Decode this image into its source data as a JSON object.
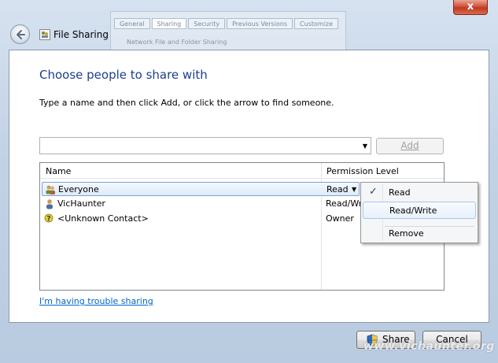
{
  "window": {
    "title": "File Sharing",
    "close_label": "x"
  },
  "background_window": {
    "tabs": [
      "General",
      "Sharing",
      "Security",
      "Previous Versions",
      "Customize"
    ],
    "active_tab": "Sharing",
    "line": "Network File and Folder Sharing"
  },
  "main": {
    "heading": "Choose people to share with",
    "instruction": "Type a name and then click Add, or click the arrow to find someone.",
    "name_input": {
      "value": "",
      "placeholder": ""
    },
    "add_label": "Add"
  },
  "list": {
    "columns": {
      "name": "Name",
      "permission": "Permission Level"
    },
    "rows": [
      {
        "name": "Everyone",
        "permission": "Read",
        "icon": "group-users-icon",
        "selected": true
      },
      {
        "name": "VicHaunter",
        "permission": "Read/Wr",
        "icon": "user-icon",
        "selected": false
      },
      {
        "name": "<Unknown Contact>",
        "permission": "Owner",
        "icon": "unknown-contact-icon",
        "selected": false
      }
    ]
  },
  "permission_menu": {
    "items": [
      {
        "label": "Read",
        "checked": true
      },
      {
        "label": "Read/Write",
        "checked": false
      },
      {
        "label": "Remove",
        "checked": false
      }
    ]
  },
  "trouble_link": "I'm having trouble sharing",
  "buttons": {
    "share": "Share",
    "cancel": "Cancel"
  },
  "watermark": "www.vichaunter.org",
  "colors": {
    "heading": "#1e3e8c",
    "link": "#0066cc",
    "close": "#c0391f"
  }
}
